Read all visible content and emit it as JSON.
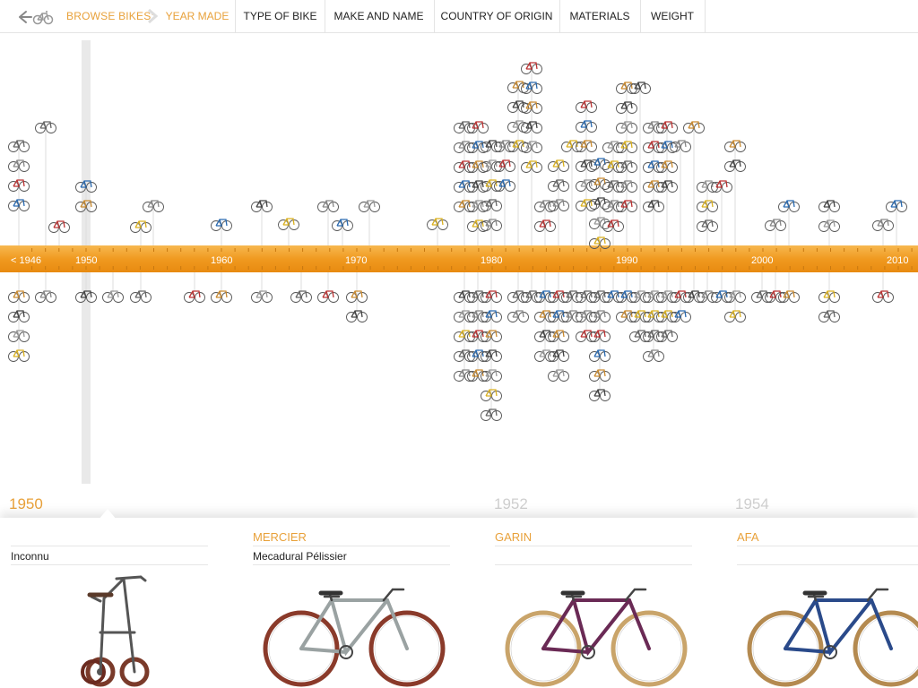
{
  "nav": {
    "browse_label": "BROWSE BIKES:",
    "tabs": [
      {
        "label": "YEAR MADE",
        "active": true
      },
      {
        "label": "TYPE OF BIKE",
        "active": false
      },
      {
        "label": "MAKE AND NAME",
        "active": false
      },
      {
        "label": "COUNTRY OF ORIGIN",
        "active": false
      },
      {
        "label": "MATERIALS",
        "active": false
      },
      {
        "label": "WEIGHT",
        "active": false
      }
    ],
    "back_icon": "back-arrow-icon",
    "logo_icon": "bike-icon"
  },
  "timeline": {
    "ruler_labels": [
      "< 1946",
      "1950",
      "1960",
      "1970",
      "1980",
      "1990",
      "2000",
      "2010"
    ],
    "accent": "#f0a030",
    "selected_year": "1950"
  },
  "years_strip": [
    {
      "label": "1950",
      "active": true
    },
    {
      "label": "1952",
      "active": false
    },
    {
      "label": "1954",
      "active": false
    }
  ],
  "cards": [
    {
      "brand": "",
      "model": "Inconnu",
      "frame": "#6b6b6b",
      "tire": "#8a3a2a",
      "type": "folding"
    },
    {
      "brand": "MERCIER",
      "model": "Mecadural Pélissier",
      "frame": "#9aa2a2",
      "tire": "#8a3a2a",
      "type": "road"
    },
    {
      "brand": "GARIN",
      "model": "",
      "frame": "#6a2a55",
      "tire": "#c9a46a",
      "type": "road"
    },
    {
      "brand": "AFA",
      "model": "",
      "frame": "#2a4a8a",
      "tire": "#b48a50",
      "type": "road"
    }
  ]
}
